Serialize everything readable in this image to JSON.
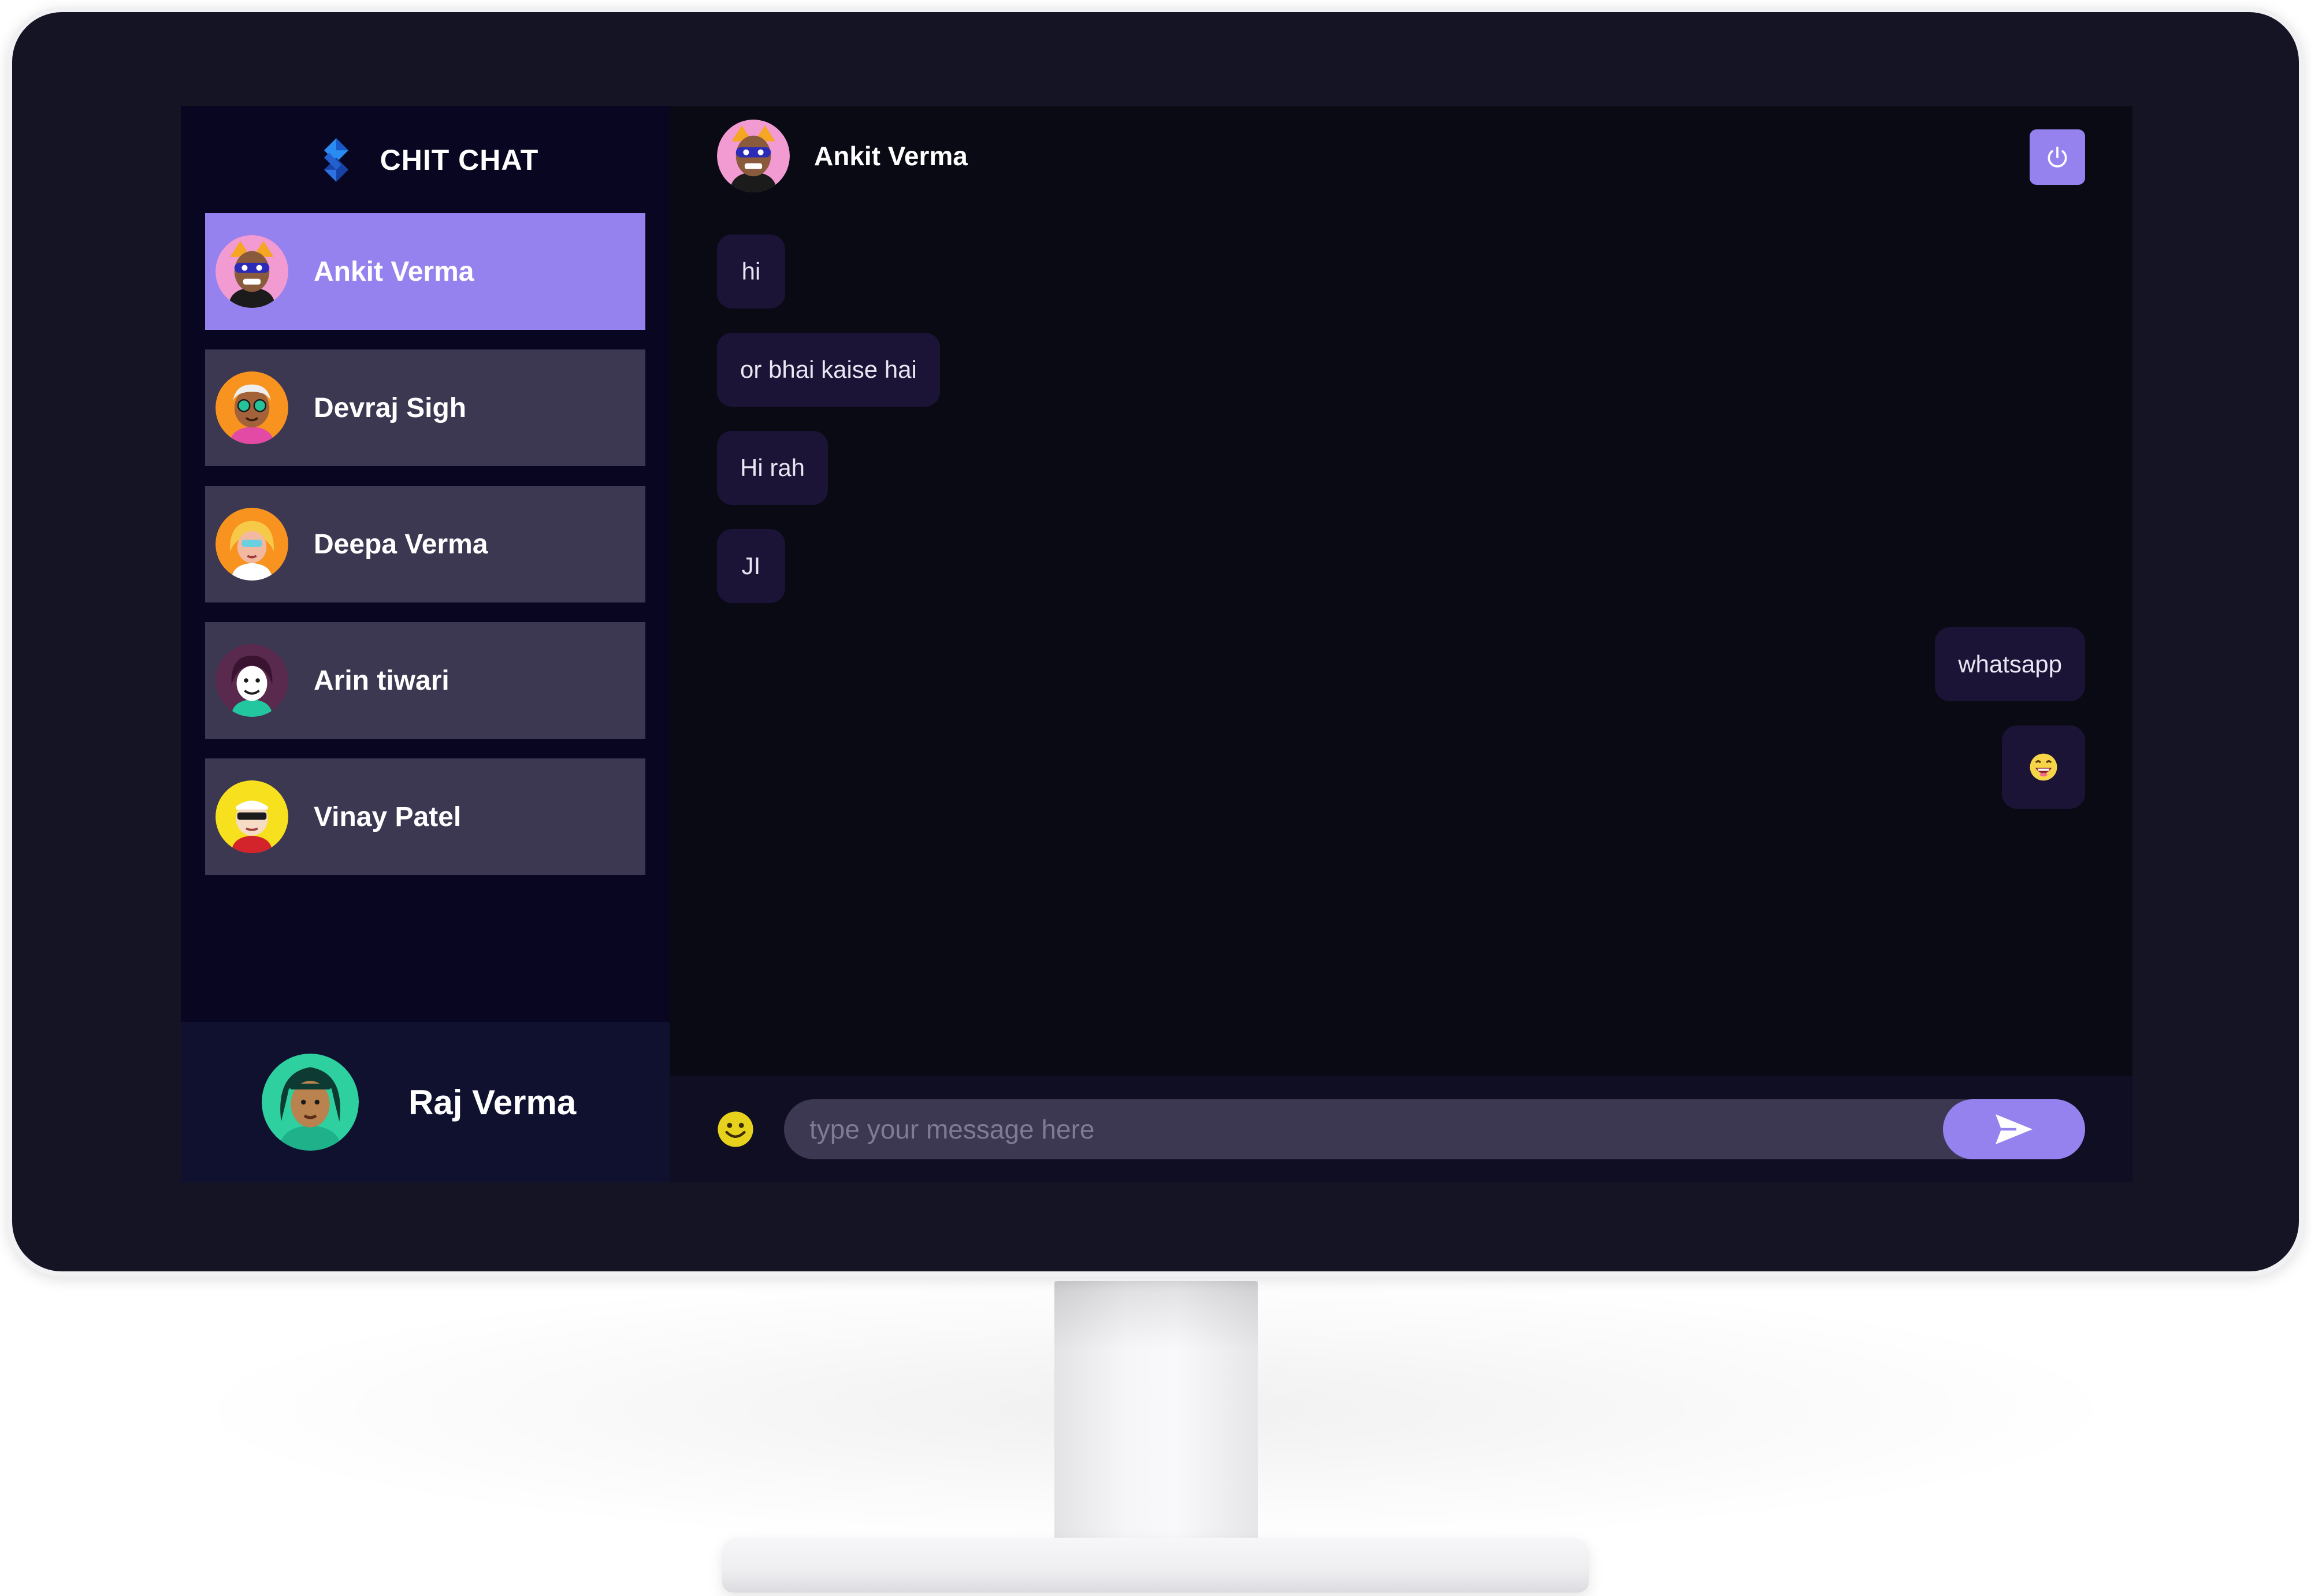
{
  "brand": {
    "name": "CHIT CHAT",
    "logo": "diamond-logo-icon"
  },
  "contacts": [
    {
      "name": "Ankit Verma",
      "active": true,
      "avatar": "avatar-ankit"
    },
    {
      "name": "Devraj Sigh",
      "active": false,
      "avatar": "avatar-devraj"
    },
    {
      "name": "Deepa Verma",
      "active": false,
      "avatar": "avatar-deepa"
    },
    {
      "name": "Arin tiwari",
      "active": false,
      "avatar": "avatar-arin"
    },
    {
      "name": "Vinay Patel",
      "active": false,
      "avatar": "avatar-vinay"
    }
  ],
  "current_user": {
    "name": "Raj Verma",
    "avatar": "avatar-raj"
  },
  "chat": {
    "header": {
      "name": "Ankit Verma",
      "avatar": "avatar-ankit",
      "logout_icon": "power-icon"
    },
    "messages": [
      {
        "text": "hi",
        "direction": "incoming"
      },
      {
        "text": "or bhai kaise hai",
        "direction": "incoming"
      },
      {
        "text": "Hi rah",
        "direction": "incoming"
      },
      {
        "text": "JI",
        "direction": "incoming"
      },
      {
        "text": "whatsapp",
        "direction": "outgoing"
      },
      {
        "text": "😄",
        "direction": "outgoing",
        "emoji": true
      }
    ],
    "composer": {
      "placeholder": "type your message here",
      "value": "",
      "emoji_icon": "smiley-icon",
      "send_icon": "send-arrow-icon"
    }
  },
  "colors": {
    "accent": "#9582ef",
    "sidebar_bg": "#080620",
    "chat_bg": "#0a0a14",
    "item_bg": "#3c3852",
    "bubble_bg": "#1c1437",
    "monitor_frame": "#151425"
  }
}
